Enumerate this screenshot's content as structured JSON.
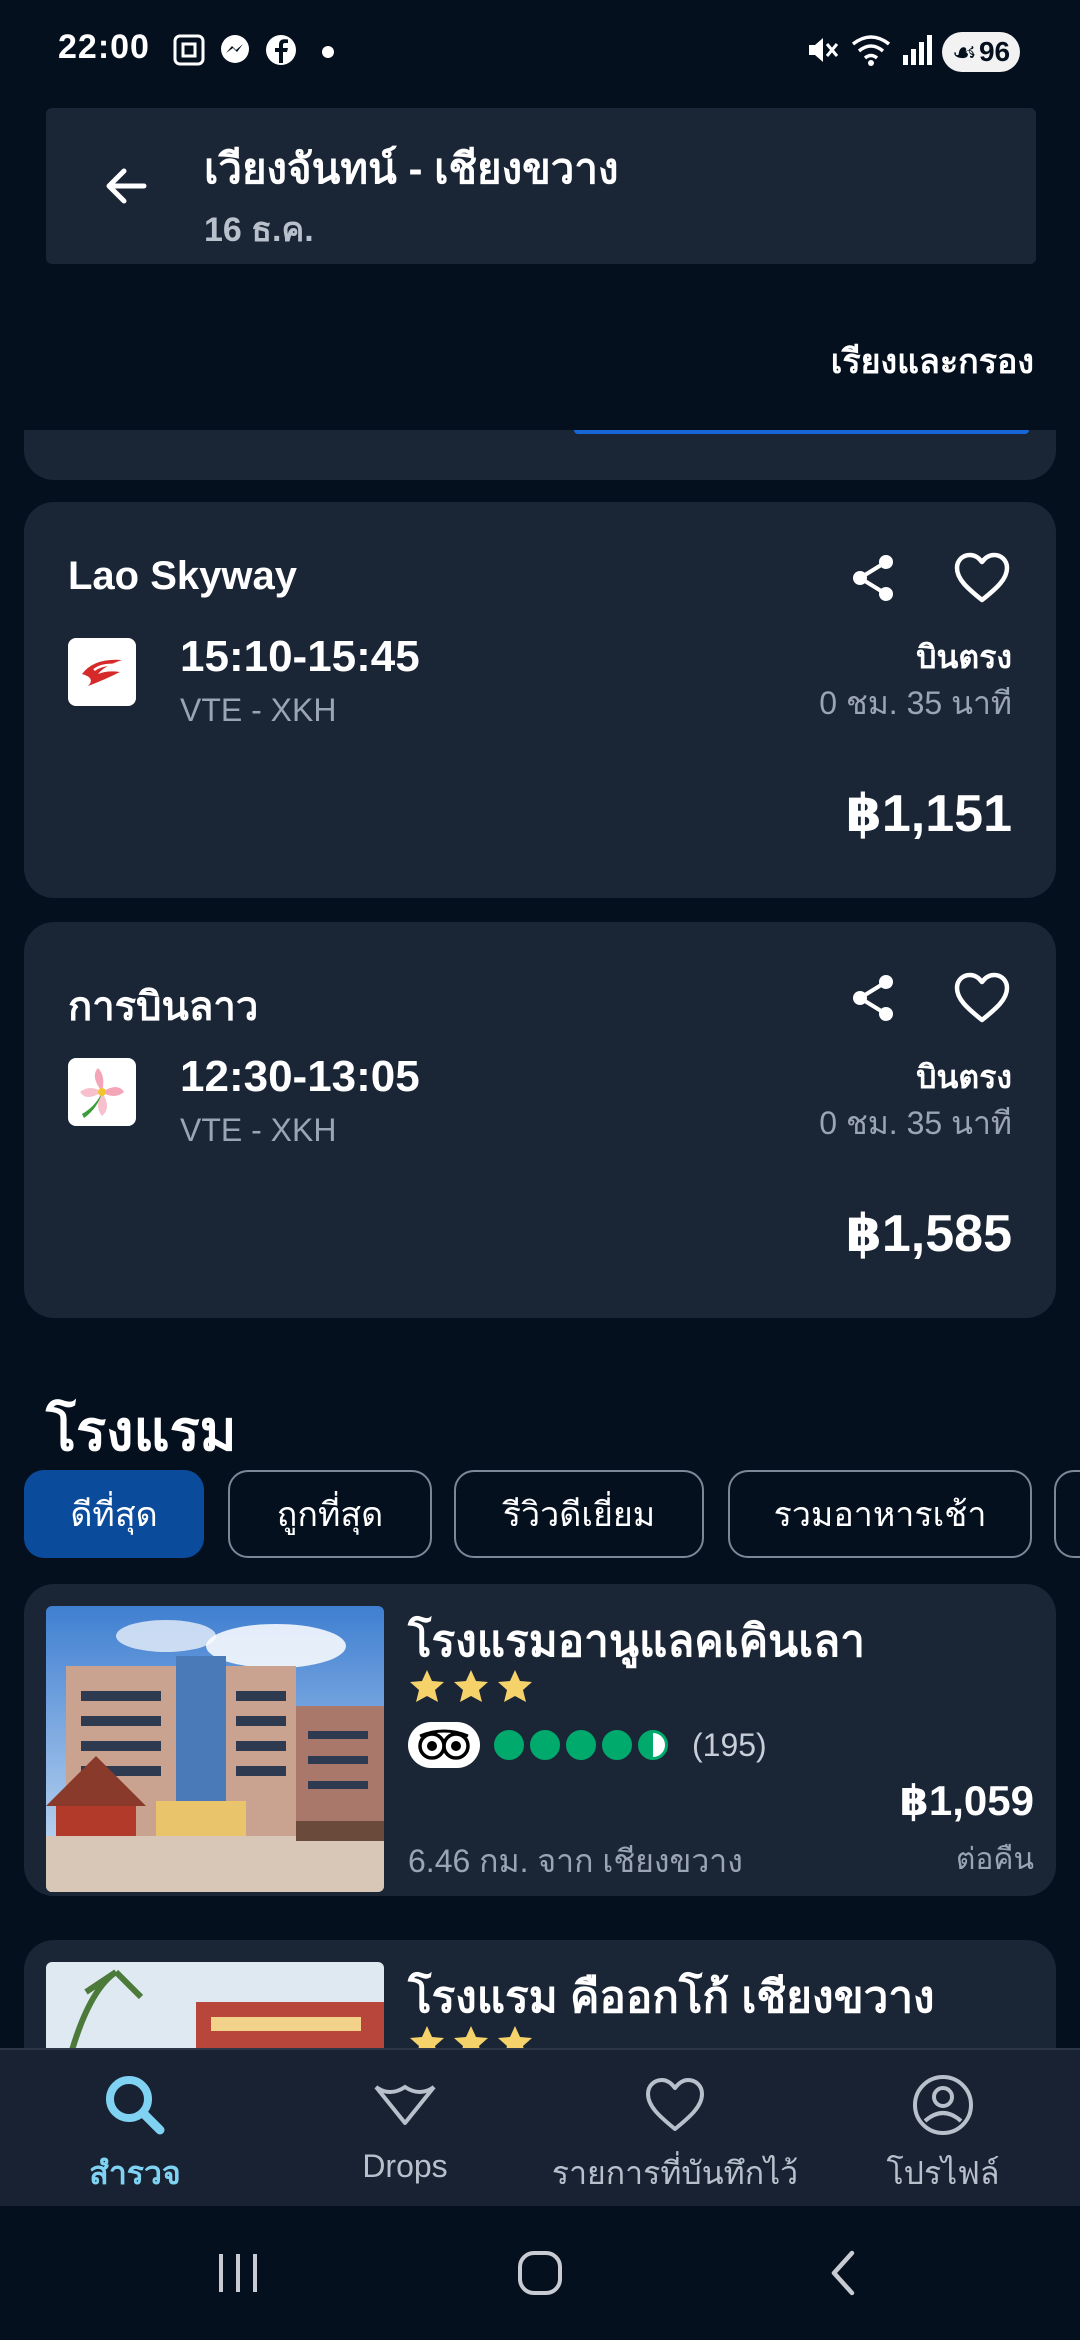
{
  "status_bar": {
    "time": "22:00",
    "battery": "96"
  },
  "header": {
    "route": "เวียงจันทน์ - เชียงขวาง",
    "date": "16 ธ.ค."
  },
  "sort_filter_label": "เรียงและกรอง",
  "flights": [
    {
      "airline": "Lao Skyway",
      "time": "15:10-15:45",
      "route": "VTE - XKH",
      "type": "บินตรง",
      "duration": "0 ชม. 35 นาที",
      "price": "฿1,151"
    },
    {
      "airline": "การบินลาว",
      "time": "12:30-13:05",
      "route": "VTE - XKH",
      "type": "บินตรง",
      "duration": "0 ชม. 35 นาที",
      "price": "฿1,585"
    }
  ],
  "hotels_section": {
    "title": "โรงแรม",
    "chips": [
      "ดีที่สุด",
      "ถูกที่สุด",
      "รีวิวดีเยี่ยม",
      "รวมอาหารเช้า"
    ],
    "active_chip": "ดีที่สุด"
  },
  "hotels": [
    {
      "name": "โรงแรมอานูแลคเคินเลา",
      "stars": 3,
      "rating_bubbles": 4.5,
      "reviews": "(195)",
      "price": "฿1,059",
      "price_unit": "ต่อคืน",
      "distance": "6.46 กม. จาก เชียงขวาง"
    },
    {
      "name": "โรงแรม คืออกโก้ เชียงขวาง",
      "stars": 3
    }
  ],
  "bottom_nav": [
    {
      "label": "สำรวจ",
      "icon": "search-icon",
      "active": true
    },
    {
      "label": "Drops",
      "icon": "drops-icon",
      "active": false
    },
    {
      "label": "รายการที่บันทึกไว้",
      "icon": "heart-icon",
      "active": false
    },
    {
      "label": "โปรไฟล์",
      "icon": "profile-icon",
      "active": false
    }
  ],
  "colors": {
    "background": "#05101f",
    "card": "#1a2536",
    "accent_chip": "#0b4b9b",
    "nav_active": "#7fd2f2",
    "tripadvisor_green": "#00aa6c",
    "star": "#f5d36a"
  }
}
